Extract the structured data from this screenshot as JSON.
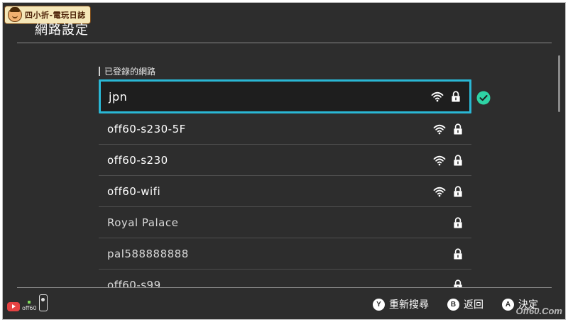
{
  "header": {
    "blog_badge": "四小折-電玩日誌",
    "title": "網路設定"
  },
  "section": {
    "label": "已登錄的網路"
  },
  "networks": [
    {
      "name": "jpn",
      "wifi": true,
      "locked": true,
      "selected": true,
      "connected": true
    },
    {
      "name": "off60-s230-5F",
      "wifi": true,
      "locked": true
    },
    {
      "name": "off60-s230",
      "wifi": true,
      "locked": true
    },
    {
      "name": "off60-wifi",
      "wifi": true,
      "locked": true
    },
    {
      "name": "Royal Palace",
      "wifi": false,
      "locked": true
    },
    {
      "name": "pal588888888",
      "wifi": false,
      "locked": true
    },
    {
      "name": "off60-s99",
      "wifi": false,
      "locked": true
    }
  ],
  "footer": {
    "player_tag": "off60",
    "actions": [
      {
        "button": "Y",
        "label": "重新搜尋"
      },
      {
        "button": "B",
        "label": "返回"
      },
      {
        "button": "A",
        "label": "決定"
      }
    ]
  },
  "watermark": "Off60.Com",
  "colors": {
    "background": "#2d2d2d",
    "selection": "#2ab7d4",
    "connected_check": "#2ed3a5"
  },
  "icons": {
    "wifi": "wifi-icon",
    "lock": "lock-icon",
    "check": "check-circle-icon"
  }
}
